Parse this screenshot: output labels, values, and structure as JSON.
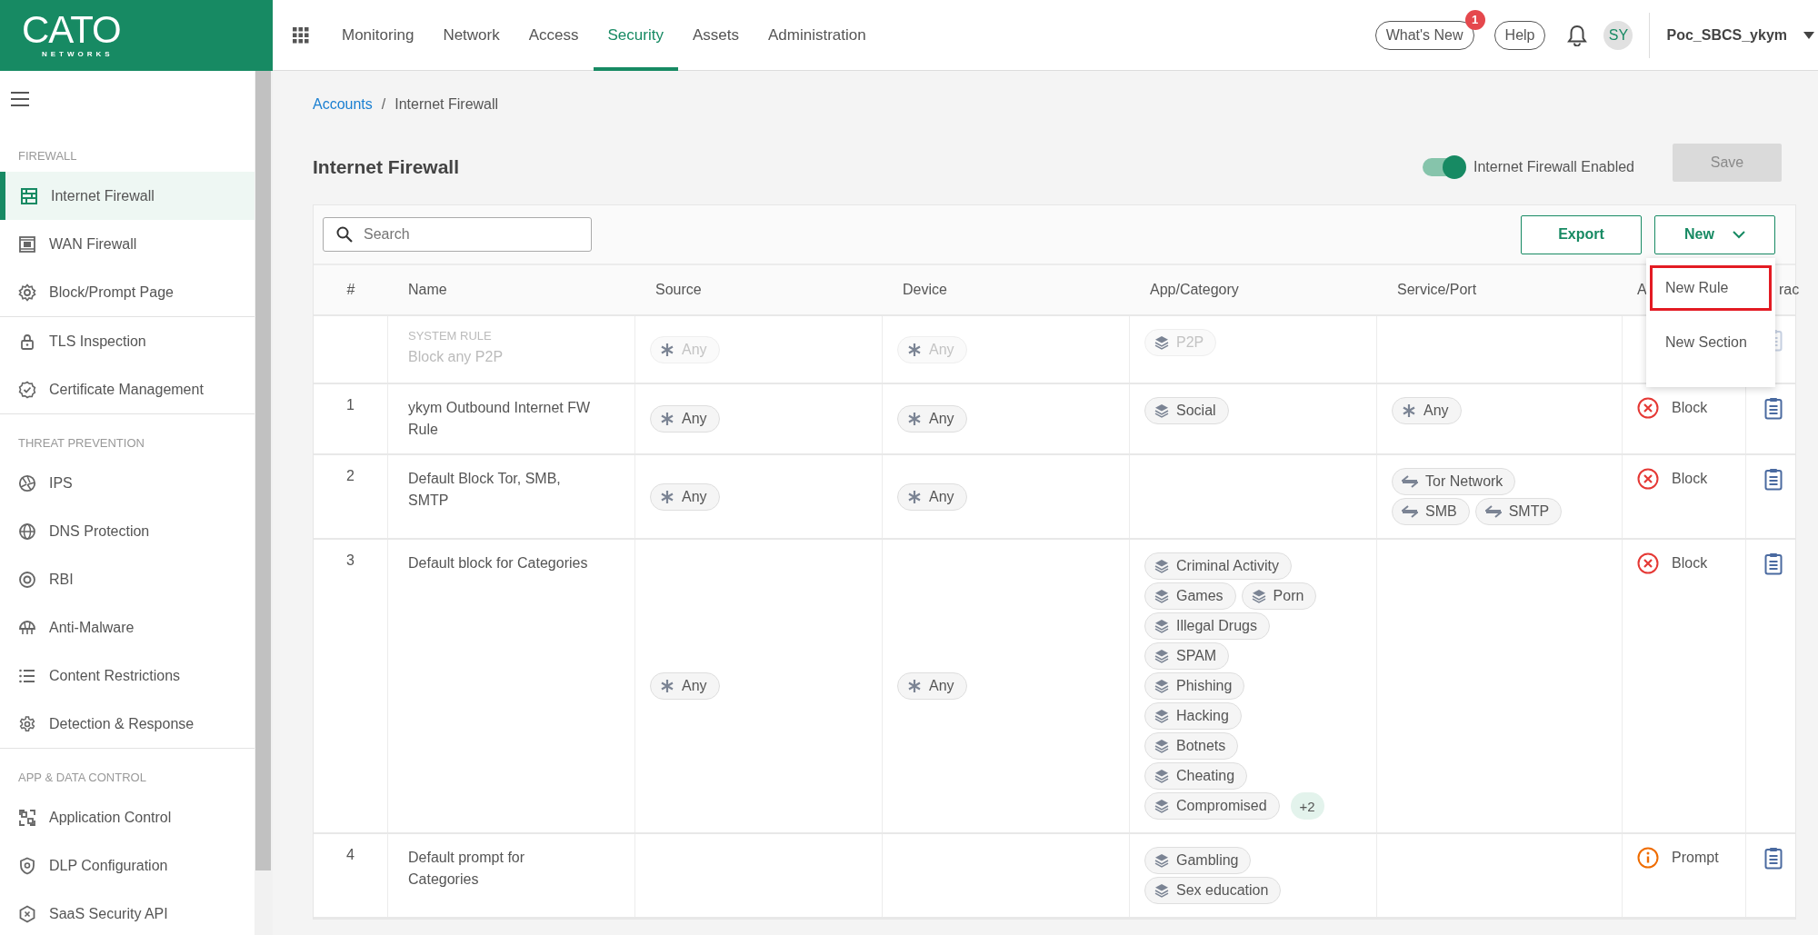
{
  "logo": {
    "name": "CATO",
    "tagline": "NETWORKS"
  },
  "nav": [
    {
      "label": "Monitoring",
      "selected": false
    },
    {
      "label": "Network",
      "selected": false
    },
    {
      "label": "Access",
      "selected": false
    },
    {
      "label": "Security",
      "selected": true
    },
    {
      "label": "Assets",
      "selected": false
    },
    {
      "label": "Administration",
      "selected": false
    }
  ],
  "header": {
    "whats_new": "What's New",
    "whats_new_badge": "1",
    "help": "Help",
    "avatar": "SY",
    "account": "Poc_SBCS_ykym"
  },
  "sidebar": {
    "sections": [
      {
        "title": "FIREWALL",
        "items": [
          {
            "label": "Internet Firewall",
            "selected": true
          },
          {
            "label": "WAN Firewall",
            "selected": false
          },
          {
            "label": "Block/Prompt Page",
            "selected": false
          }
        ]
      },
      {
        "items": [
          {
            "label": "TLS Inspection",
            "selected": false
          },
          {
            "label": "Certificate Management",
            "selected": false
          }
        ]
      },
      {
        "title": "THREAT PREVENTION",
        "items": [
          {
            "label": "IPS",
            "selected": false
          },
          {
            "label": "DNS Protection",
            "selected": false
          },
          {
            "label": "RBI",
            "selected": false
          },
          {
            "label": "Anti-Malware",
            "selected": false
          },
          {
            "label": "Content Restrictions",
            "selected": false
          },
          {
            "label": "Detection & Response",
            "selected": false
          }
        ]
      },
      {
        "title": "APP & DATA CONTROL",
        "items": [
          {
            "label": "Application Control",
            "selected": false
          },
          {
            "label": "DLP Configuration",
            "selected": false
          },
          {
            "label": "SaaS Security API",
            "selected": false
          }
        ]
      }
    ]
  },
  "breadcrumb": {
    "separator": "/",
    "items": [
      {
        "label": "Accounts",
        "link": true
      },
      {
        "label": "Internet Firewall",
        "link": false
      }
    ]
  },
  "page": {
    "title": "Internet Firewall",
    "toggle": {
      "label": "Internet Firewall Enabled",
      "on": true
    },
    "save": {
      "label": "Save",
      "disabled": true
    }
  },
  "toolbar": {
    "search": {
      "placeholder": "Search"
    },
    "export": "Export",
    "new": "New"
  },
  "menu": [
    {
      "label": "New Rule",
      "selected": true
    },
    {
      "label": "New Section",
      "selected": false
    }
  ],
  "table": {
    "columns": [
      "#",
      "Name",
      "Source",
      "Device",
      "App/Category",
      "Service/Port",
      "A",
      "rac"
    ],
    "rows": [
      {
        "system": true,
        "tag": "SYSTEM RULE",
        "name": "Block any P2P",
        "source": [
          {
            "kind": "any",
            "label": "Any"
          }
        ],
        "device": [
          {
            "kind": "any",
            "label": "Any"
          }
        ],
        "app": [
          {
            "kind": "category",
            "label": "P2P"
          }
        ]
      },
      {
        "system": false,
        "number": "1",
        "name": "ykym Outbound Internet FW Rule",
        "source": [
          {
            "kind": "any",
            "label": "Any"
          }
        ],
        "device": [
          {
            "kind": "any",
            "label": "Any"
          }
        ],
        "app": [
          {
            "kind": "category",
            "label": "Social"
          }
        ],
        "service": [
          {
            "kind": "any",
            "label": "Any"
          }
        ],
        "action": {
          "kind": "block",
          "label": "Block"
        }
      },
      {
        "system": false,
        "number": "2",
        "name": "Default Block Tor, SMB, SMTP",
        "source": [
          {
            "kind": "any",
            "label": "Any"
          }
        ],
        "device": [
          {
            "kind": "any",
            "label": "Any"
          }
        ],
        "service": [
          {
            "kind": "service",
            "label": "Tor Network"
          },
          {
            "kind": "service",
            "label": "SMB"
          },
          {
            "kind": "service",
            "label": "SMTP"
          }
        ],
        "action": {
          "kind": "block",
          "label": "Block"
        }
      },
      {
        "system": false,
        "number": "3",
        "name": "Default block for Categories",
        "source": [
          {
            "kind": "any",
            "label": "Any"
          }
        ],
        "device": [
          {
            "kind": "any",
            "label": "Any"
          }
        ],
        "app": [
          {
            "kind": "category",
            "label": "Criminal Activity"
          },
          {
            "kind": "category",
            "label": "Games"
          },
          {
            "kind": "category",
            "label": "Porn"
          },
          {
            "kind": "category",
            "label": "Illegal Drugs"
          },
          {
            "kind": "category",
            "label": "SPAM"
          },
          {
            "kind": "category",
            "label": "Phishing"
          },
          {
            "kind": "category",
            "label": "Hacking"
          },
          {
            "kind": "category",
            "label": "Botnets"
          },
          {
            "kind": "category",
            "label": "Cheating"
          },
          {
            "kind": "category",
            "label": "Compromised"
          }
        ],
        "app_more": "+2",
        "action": {
          "kind": "block",
          "label": "Block"
        }
      },
      {
        "system": false,
        "number": "4",
        "name": "Default prompt for Categories",
        "app": [
          {
            "kind": "category",
            "label": "Gambling"
          },
          {
            "kind": "category",
            "label": "Sex education"
          }
        ],
        "action": {
          "kind": "prompt",
          "label": "Prompt"
        }
      }
    ]
  }
}
